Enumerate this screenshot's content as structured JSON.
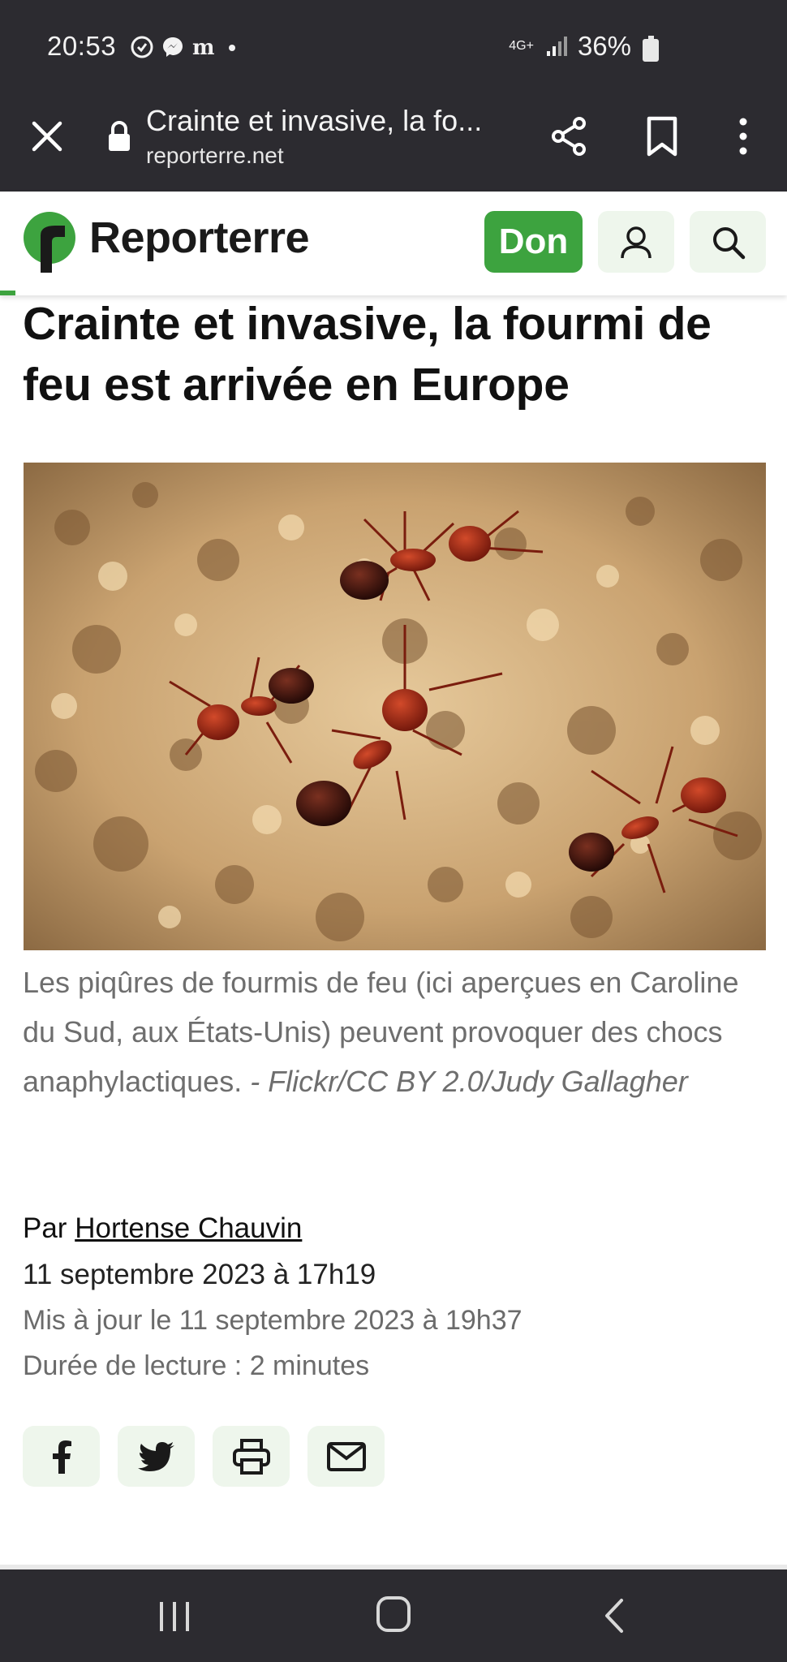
{
  "status_bar": {
    "time": "20:53",
    "network": "4G+",
    "battery": "36%"
  },
  "browser_toolbar": {
    "title": "Crainte et invasive, la fo...",
    "url": "reporterre.net"
  },
  "site_header": {
    "logo_text": "Reporterre",
    "don_label": "Don",
    "brand_color": "#3da33f",
    "reading_progress": 0.02
  },
  "article": {
    "headline": "Crainte et invasive, la fourmi de feu est arrivée en Europe",
    "image_alt": "Fourmis de feu",
    "caption_text": "Les piqûres de fourmis de feu (ici aperçues en Caroline du Sud, aux États-Unis) peuvent provoquer des chocs anaphylactiques.",
    "caption_credit": " - Flickr/CC BY 2.0/Judy Gallagher",
    "byline_prefix": "Par ",
    "author": "Hortense Chauvin",
    "date": "11 septembre 2023 à 17h19",
    "updated": "Mis à jour le 11 septembre 2023 à 19h37",
    "reading_time": "Durée de lecture : 2 minutes"
  },
  "share_buttons": {
    "icons": [
      "facebook-icon",
      "twitter-icon",
      "print-icon",
      "mail-icon"
    ]
  }
}
